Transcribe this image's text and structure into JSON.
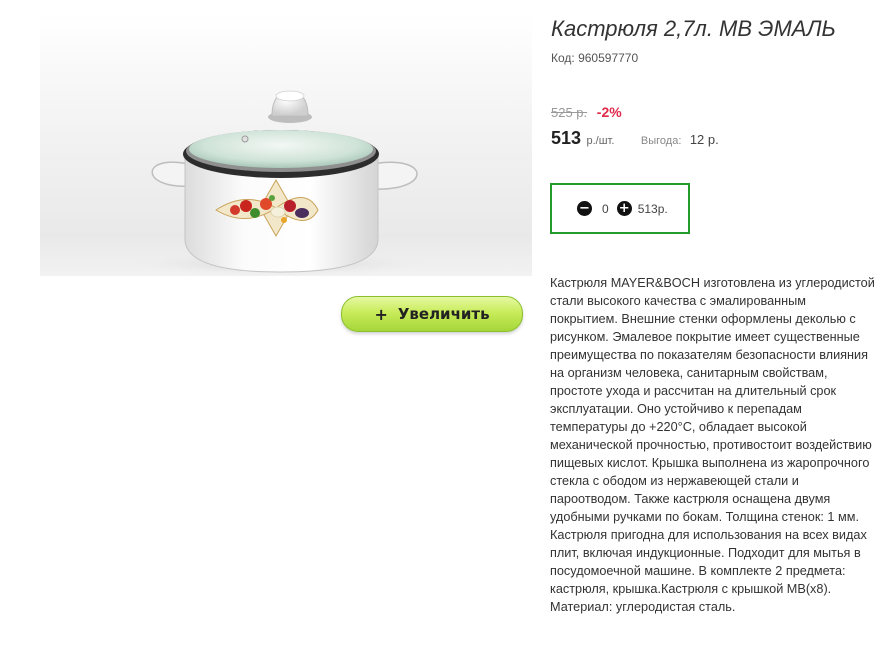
{
  "product": {
    "title": "Кастрюля 2,7л. MB ЭМАЛЬ",
    "code_line": "Код: 960597770",
    "old_price": "525 р.",
    "discount": "-2%",
    "price": "513",
    "price_unit": "р./шт.",
    "savings_label": "Выгода:",
    "savings_value": "12 р.",
    "zoom_button_label": "Увеличить",
    "zoom_button_icon": "+",
    "description": "Кастрюля MAYER&BOCH изготовлена из углеродистой стали высокого качества с эмалированным покрытием. Внешние стенки оформлены деколью с рисунком. Эмалевое покрытие имеет существенные преимущества по показателям безопасности влияния на организм человека, санитарным свойствам, простоте ухода и рассчитан на длительный срок эксплуатации. Оно устойчиво к перепадам температуры до +220°C, обладает высокой механической прочностью, противостоит воздействию пищевых кислот. Крышка выполнена из жаропрочного стекла с ободом из нержавеющей стали и пароотводом. Также кастрюля оснащена двумя удобными ручками по бокам. Толщина стенок: 1 мм. Кастрюля пригодна для использования на всех видах плит, включая индукционные. Подходит для мытья в посудомоечной машине. В комплекте 2 предмета: кастрюля, крышка.Кастрюля с крышкой MB(x8). Материал: углеродистая сталь."
  },
  "cart": {
    "minus_icon": "minus-circle-icon",
    "plus_icon": "plus-circle-icon",
    "quantity": "0",
    "total": "513р."
  },
  "colors": {
    "discount": "#e0284a",
    "cart_border": "#239b2e",
    "zoom_button": "#c8ec5a"
  }
}
